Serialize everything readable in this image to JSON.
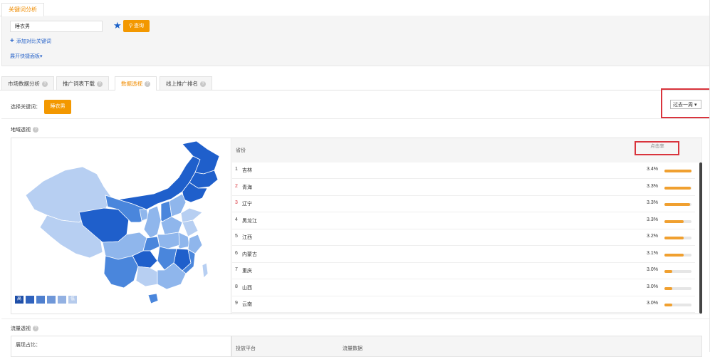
{
  "top_tab": {
    "label": "关键词分析"
  },
  "search": {
    "value": "睡衣男",
    "query_label": "查询"
  },
  "links": {
    "add_compare": "添加对比关键词",
    "expand_panel": "展开快捷面板▾"
  },
  "tabs": [
    {
      "label": "市场数据分析",
      "active": false
    },
    {
      "label": "推广词表下载",
      "active": false
    },
    {
      "label": "数据透视",
      "active": true
    },
    {
      "label": "线上推广排名",
      "active": false
    }
  ],
  "keyword_select": {
    "label": "选择关键词：",
    "value": "睡衣男"
  },
  "period": {
    "selected": "过去一周 ▾"
  },
  "region": {
    "title": "地域透视",
    "legend": {
      "high": "高",
      "low": "低"
    },
    "table": {
      "col_province": "省份",
      "col_metric": "点击率",
      "rows": [
        {
          "rank": "1",
          "name": "吉林",
          "value": "3.4%",
          "fill": 1.0
        },
        {
          "rank": "2",
          "name": "青海",
          "value": "3.3%",
          "fill": 0.97
        },
        {
          "rank": "3",
          "name": "辽宁",
          "value": "3.3%",
          "fill": 0.96
        },
        {
          "rank": "4",
          "name": "黑龙江",
          "value": "3.3%",
          "fill": 0.72
        },
        {
          "rank": "5",
          "name": "江西",
          "value": "3.2%",
          "fill": 0.7
        },
        {
          "rank": "6",
          "name": "内蒙古",
          "value": "3.1%",
          "fill": 0.7
        },
        {
          "rank": "7",
          "name": "重庆",
          "value": "3.0%",
          "fill": 0.3
        },
        {
          "rank": "8",
          "name": "山西",
          "value": "3.0%",
          "fill": 0.3
        },
        {
          "rank": "9",
          "name": "云南",
          "value": "3.0%",
          "fill": 0.3
        }
      ]
    }
  },
  "flow": {
    "title": "流量透视",
    "exposure_label": "展现占比：",
    "col_platform": "投放平台",
    "col_flow": "流量数据"
  },
  "colors": {
    "accent": "#f39800",
    "link": "#2763c9",
    "highlight": "#d9343c",
    "map_dark": "#1f5fcb",
    "map_mid": "#4a86dc",
    "map_light": "#8fb6ec",
    "map_pale": "#b7cff2"
  }
}
